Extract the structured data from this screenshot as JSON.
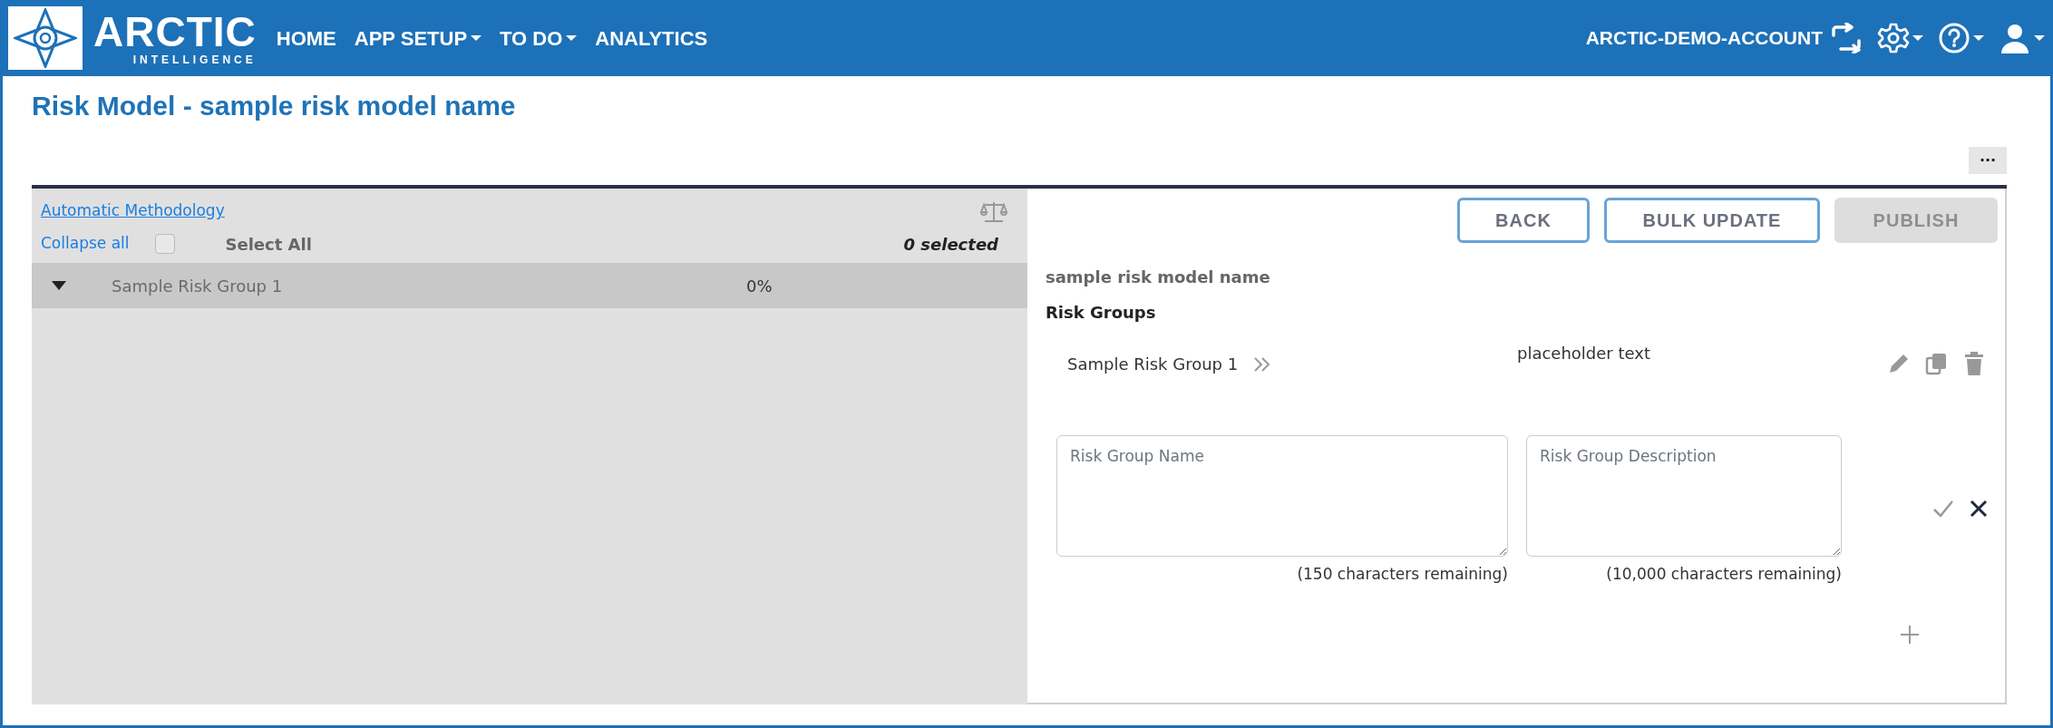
{
  "header": {
    "logo": {
      "title": "ARCTIC",
      "subtitle": "INTELLIGENCE"
    },
    "nav": [
      {
        "label": "HOME",
        "dropdown": false
      },
      {
        "label": "APP SETUP",
        "dropdown": true
      },
      {
        "label": "TO DO",
        "dropdown": true
      },
      {
        "label": "ANALYTICS",
        "dropdown": false
      }
    ],
    "account": "ARCTIC-DEMO-ACCOUNT"
  },
  "page": {
    "title": "Risk Model - sample risk model name",
    "more_button": "···"
  },
  "left_panel": {
    "methodology_link": "Automatic Methodology",
    "collapse_all": "Collapse all",
    "select_all": {
      "label": "Select All",
      "checked": false
    },
    "selected_count": "0 selected",
    "tree": [
      {
        "label": "Sample Risk Group 1",
        "percent": "0%",
        "expanded": true
      }
    ]
  },
  "right_panel": {
    "buttons": [
      {
        "label": "BACK",
        "disabled": false
      },
      {
        "label": "BULK UPDATE",
        "disabled": false
      },
      {
        "label": "PUBLISH",
        "disabled": true
      }
    ],
    "model_name": "sample risk model name",
    "section_title": "Risk Groups",
    "groups": [
      {
        "name": "Sample Risk Group 1",
        "description": "placeholder text"
      }
    ],
    "form": {
      "name_field": {
        "placeholder": "Risk Group Name",
        "remaining": "(150 characters remaining)"
      },
      "description_field": {
        "placeholder": "Risk Group Description",
        "remaining": "(10,000 characters remaining)"
      }
    }
  }
}
